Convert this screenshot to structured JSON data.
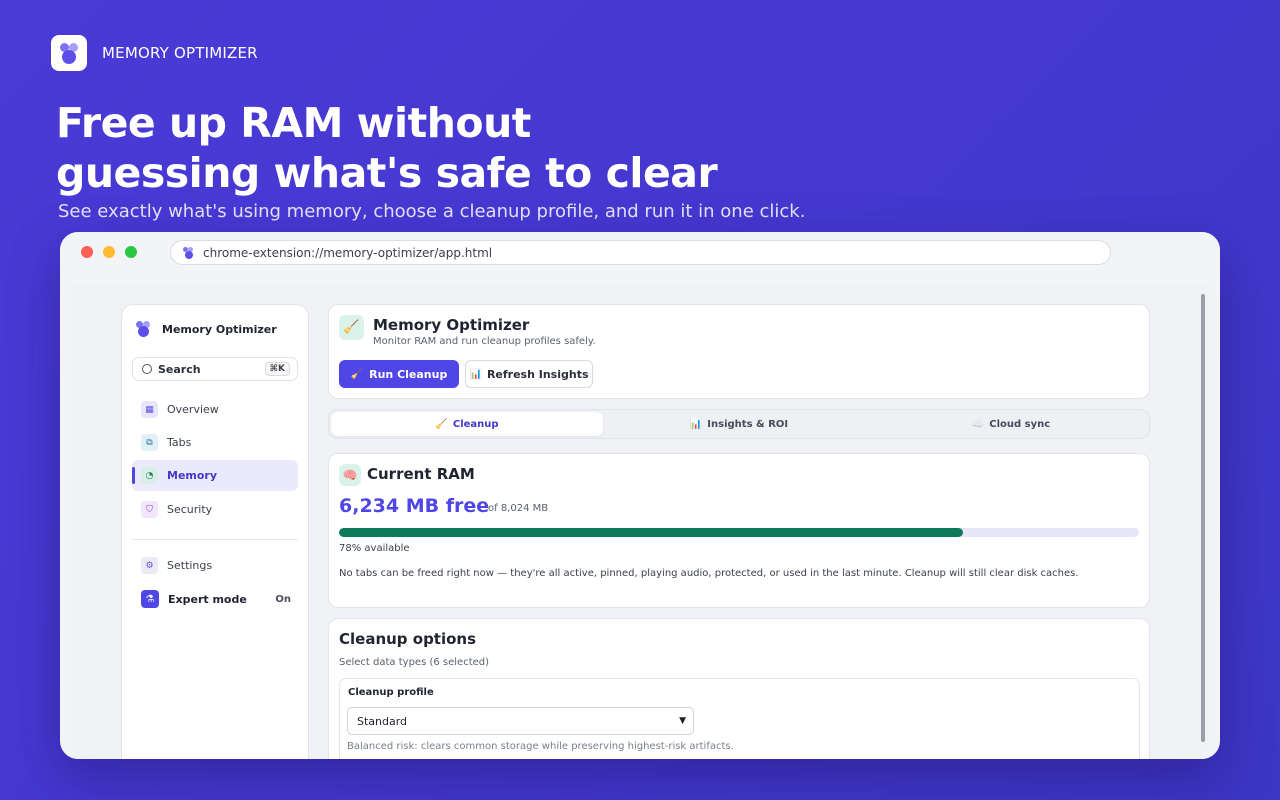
{
  "promo": {
    "brand": "MEMORY OPTIMIZER",
    "headline_line1": "Free up RAM without",
    "headline_line2": "guessing what's safe to clear",
    "subline": "See exactly what's using memory, choose a cleanup profile, and run it in one click."
  },
  "browser": {
    "url": "chrome-extension://memory-optimizer/app.html"
  },
  "sidebar": {
    "brand": "Memory Optimizer",
    "search_label": "Search",
    "search_shortcut": "⌘K",
    "items": [
      {
        "label": "Overview",
        "icon": "grid-icon"
      },
      {
        "label": "Tabs",
        "icon": "tabs-icon"
      },
      {
        "label": "Memory",
        "icon": "gauge-icon",
        "active": true
      },
      {
        "label": "Security",
        "icon": "shield-icon"
      }
    ],
    "settings_label": "Settings",
    "expert_label": "Expert mode",
    "expert_state": "On"
  },
  "header": {
    "icon": "🧹",
    "title": "Memory Optimizer",
    "subtitle": "Monitor RAM and run cleanup profiles safely.",
    "run_icon": "🧹",
    "run_label": "Run Cleanup",
    "refresh_icon": "📊",
    "refresh_label": "Refresh Insights"
  },
  "tabs": [
    {
      "icon": "🧹",
      "label": "Cleanup",
      "active": true
    },
    {
      "icon": "📊",
      "label": "Insights & ROI"
    },
    {
      "icon": "☁️",
      "label": "Cloud sync"
    }
  ],
  "ram": {
    "icon": "🧠",
    "title": "Current RAM",
    "free": "6,234 MB free",
    "total": "of 8,024 MB",
    "available_pct": 78,
    "available_text": "78% available",
    "note": "No tabs can be freed right now — they're all active, pinned, playing audio, protected, or used in the last minute. Cleanup will still clear disk caches."
  },
  "options": {
    "title": "Cleanup options",
    "subtitle": "Select data types (6 selected)",
    "profile_label": "Cleanup profile",
    "profile_value": "Standard",
    "profile_desc": "Balanced risk: clears common storage while preserving highest-risk artifacts."
  },
  "colors": {
    "accent": "#4f46e5",
    "progress": "#0f7a5a",
    "background": "#4438cf"
  }
}
